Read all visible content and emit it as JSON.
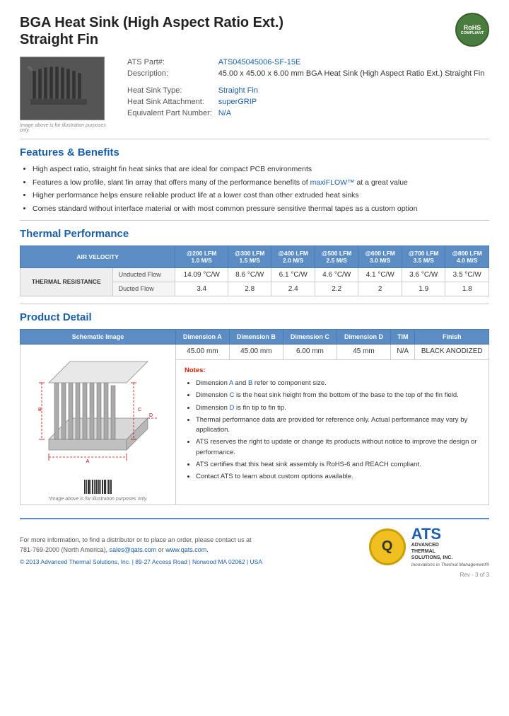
{
  "header": {
    "title_line1": "BGA Heat Sink (High Aspect Ratio Ext.)",
    "title_line2": "Straight Fin",
    "rohs": {
      "line1": "RoHS",
      "line2": "COMPLIANT"
    }
  },
  "product_info": {
    "part_label": "ATS Part#:",
    "part_number": "ATS045045006-SF-15E",
    "description_label": "Description:",
    "description": "45.00 x 45.00 x 6.00 mm BGA Heat Sink (High Aspect Ratio Ext.) Straight Fin",
    "type_label": "Heat Sink Type:",
    "type_value": "Straight Fin",
    "attachment_label": "Heat Sink Attachment:",
    "attachment_value": "superGRIP",
    "equiv_label": "Equivalent Part Number:",
    "equiv_value": "N/A"
  },
  "image_note": "Image above is for illustration purposes only.",
  "features_title": "Features & Benefits",
  "features": [
    "High aspect ratio, straight fin heat sinks that are ideal for compact PCB environments",
    "Features a low profile, slant fin array that offers many of the performance benefits of maxiFLOW™ at a great value",
    "Higher performance helps ensure reliable product life at a lower cost than other extruded heat sinks",
    "Comes standard without interface material or with most common pressure sensitive thermal tapes as a custom option"
  ],
  "thermal_title": "Thermal Performance",
  "thermal_table": {
    "header_col1": "AIR VELOCITY",
    "cols": [
      {
        "line1": "@200 LFM",
        "line2": "1.0 M/S"
      },
      {
        "line1": "@300 LFM",
        "line2": "1.5 M/S"
      },
      {
        "line1": "@400 LFM",
        "line2": "2.0 M/S"
      },
      {
        "line1": "@500 LFM",
        "line2": "2.5 M/S"
      },
      {
        "line1": "@600 LFM",
        "line2": "3.0 M/S"
      },
      {
        "line1": "@700 LFM",
        "line2": "3.5 M/S"
      },
      {
        "line1": "@800 LFM",
        "line2": "4.0 M/S"
      }
    ],
    "side_header": "THERMAL RESISTANCE",
    "rows": [
      {
        "label": "Unducted Flow",
        "values": [
          "14.09 °C/W",
          "8.6 °C/W",
          "6.1 °C/W",
          "4.6 °C/W",
          "4.1 °C/W",
          "3.6 °C/W",
          "3.5 °C/W"
        ]
      },
      {
        "label": "Ducted Flow",
        "values": [
          "3.4",
          "2.8",
          "2.4",
          "2.2",
          "2",
          "1.9",
          "1.8"
        ]
      }
    ]
  },
  "product_detail_title": "Product Detail",
  "detail_table": {
    "headers": [
      "Schematic Image",
      "Dimension A",
      "Dimension B",
      "Dimension C",
      "Dimension D",
      "TIM",
      "Finish"
    ],
    "row": {
      "dim_a": "45.00 mm",
      "dim_b": "45.00 mm",
      "dim_c": "6.00 mm",
      "dim_d": "45 mm",
      "tim": "N/A",
      "finish": "BLACK ANODIZED"
    }
  },
  "notes": {
    "title": "Notes:",
    "items": [
      "Dimension A and B refer to component size.",
      "Dimension C is the heat sink height from the bottom of the base to the top of the fin field.",
      "Dimension D is fin tip to fin tip.",
      "Thermal performance data are provided for reference only. Actual performance may vary by application.",
      "ATS reserves the right to update or change its products without notice to improve the design or performance.",
      "ATS certifies that this heat sink assembly is RoHS-6 and REACH compliant.",
      "Contact ATS to learn about custom options available."
    ]
  },
  "schematic_note": "*Image above is for illustration purposes only.",
  "footer": {
    "contact_text": "For more information, to find a distributor or to place an order, please contact us at",
    "phone": "781-769-2000 (North America),",
    "email": "sales@qats.com",
    "or_text": "or",
    "website": "www.qats.com.",
    "copyright": "© 2013 Advanced Thermal Solutions, Inc. | 89-27 Access Road | Norwood MA 02062 | USA",
    "ats_letter": "Q",
    "ats_brand": "ATS",
    "ats_sub1": "ADVANCED",
    "ats_sub2": "THERMAL",
    "ats_sub3": "SOLUTIONS, INC.",
    "ats_tagline": "Innovations in Thermal Management®",
    "page_num": "Rev - 3 of 3"
  }
}
